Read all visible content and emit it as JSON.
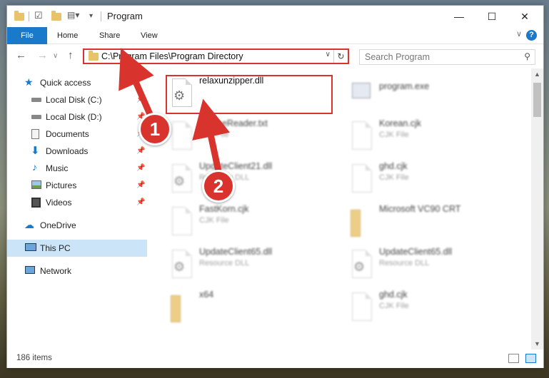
{
  "window": {
    "title": "Program",
    "minimize": "—",
    "maximize": "☐",
    "close": "✕"
  },
  "ribbon": {
    "tabs": [
      "File",
      "Home",
      "Share",
      "View"
    ],
    "help": "?"
  },
  "nav": {
    "back": "←",
    "forward": "→",
    "up": "↑",
    "address": "C:\\Program Files\\Program Directory",
    "search_placeholder": "Search Program"
  },
  "sidebar": {
    "items": [
      {
        "label": "Quick access",
        "icon": "star-icon"
      },
      {
        "label": "Local Disk (C:)",
        "icon": "drive-icon"
      },
      {
        "label": "Local Disk (D:)",
        "icon": "drive-icon"
      },
      {
        "label": "Documents",
        "icon": "documents-icon"
      },
      {
        "label": "Downloads",
        "icon": "download-icon"
      },
      {
        "label": "Music",
        "icon": "music-icon"
      },
      {
        "label": "Pictures",
        "icon": "pictures-icon"
      },
      {
        "label": "Videos",
        "icon": "videos-icon"
      },
      {
        "label": "OneDrive",
        "icon": "cloud-icon"
      },
      {
        "label": "This PC",
        "icon": "computer-icon"
      },
      {
        "label": "Network",
        "icon": "network-icon"
      }
    ]
  },
  "files": [
    {
      "name": "relaxunzipper.dll",
      "type": ""
    },
    {
      "name": "program.exe",
      "type": ""
    },
    {
      "name": "EngineReader.txt",
      "type": "CJK File"
    },
    {
      "name": "Korean.cjk",
      "type": "CJK File"
    },
    {
      "name": "UpdateClient21.dll",
      "type": "Resource DLL"
    },
    {
      "name": "ghd.cjk",
      "type": "CJK File"
    },
    {
      "name": "FastKorn.cjk",
      "type": "CJK File"
    },
    {
      "name": "Microsoft VC90 CRT",
      "type": ""
    },
    {
      "name": "UpdateClient65.dll",
      "type": "Resource DLL"
    },
    {
      "name": "UpdateClient65.dll",
      "type": "Resource DLL"
    },
    {
      "name": "x64",
      "type": ""
    },
    {
      "name": "ghd.cjk",
      "type": "CJK File"
    }
  ],
  "status": {
    "item_count": "186 items"
  },
  "annotations": {
    "step1": "1",
    "step2": "2",
    "highlight_color": "#d9332e"
  }
}
